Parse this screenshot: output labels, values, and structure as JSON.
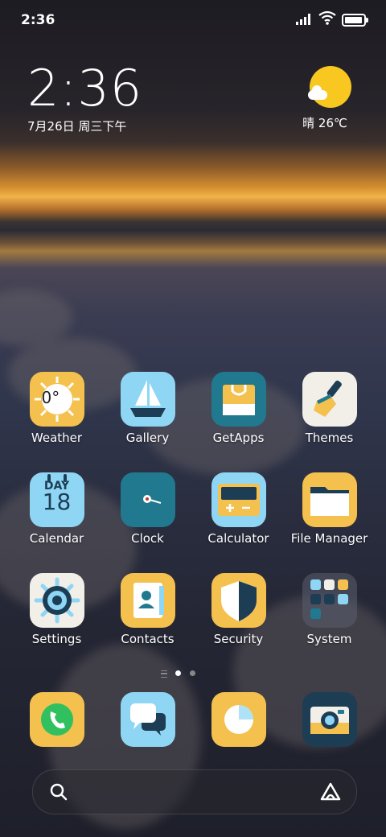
{
  "status_bar": {
    "time": "2:36",
    "icons": [
      "signal-icon",
      "wifi-icon",
      "battery-icon"
    ],
    "battery_level": 0.95
  },
  "clock_widget": {
    "time": "2:36",
    "date": "7月26日 周三下午"
  },
  "weather_widget": {
    "icon": "sunny-cloud-icon",
    "text": "晴 26℃"
  },
  "apps": [
    {
      "name": "Weather",
      "icon": "weather-icon",
      "badge": "0°"
    },
    {
      "name": "Gallery",
      "icon": "gallery-icon"
    },
    {
      "name": "GetApps",
      "icon": "getapps-icon"
    },
    {
      "name": "Themes",
      "icon": "themes-icon"
    },
    {
      "name": "Calendar",
      "icon": "calendar-icon",
      "badge_top": "DAY",
      "badge_num": "18"
    },
    {
      "name": "Clock",
      "icon": "clock-icon"
    },
    {
      "name": "Calculator",
      "icon": "calculator-icon"
    },
    {
      "name": "File Manager",
      "icon": "file-manager-icon"
    },
    {
      "name": "Settings",
      "icon": "settings-icon"
    },
    {
      "name": "Contacts",
      "icon": "contacts-icon"
    },
    {
      "name": "Security",
      "icon": "security-icon"
    },
    {
      "name": "System",
      "icon": "system-folder-icon"
    }
  ],
  "page_indicator": {
    "pages": 2,
    "current": 1
  },
  "dock": [
    {
      "icon": "phone-icon"
    },
    {
      "icon": "messages-icon"
    },
    {
      "icon": "browser-icon"
    },
    {
      "icon": "camera-icon"
    }
  ],
  "search_bar": {
    "left_icon": "search-icon",
    "right_icon": "assistant-icon"
  },
  "colors": {
    "yellow": "#f4c04e",
    "sky": "#8fd6f4",
    "teal": "#20798f",
    "cream": "#f2efe8",
    "navy": "#1d3d55"
  }
}
